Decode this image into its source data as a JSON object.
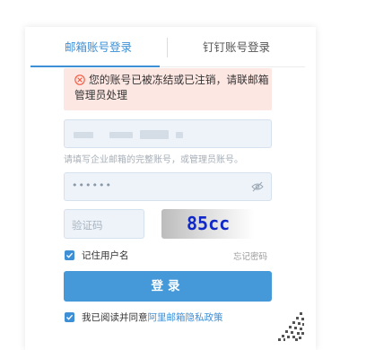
{
  "tabs": {
    "email_login": "邮箱账号登录",
    "dingtalk_login": "钉钉账号登录"
  },
  "alert": {
    "message": "您的账号已被冻结或已注销，请联邮箱管理员处理",
    "icon": "error-circle-icon",
    "color": "#f1573d"
  },
  "email": {
    "hint": "请填写企业邮箱的完整账号，或管理员账号。"
  },
  "password": {
    "masked_value": "••••••",
    "icon": "eye-slash-icon"
  },
  "captcha": {
    "placeholder": "验证码",
    "image_text": "85cc"
  },
  "remember": {
    "label": "记住用户名",
    "checked": true
  },
  "forgot_password": "忘记密码",
  "login_button": "登录",
  "agreement": {
    "prefix": "我已阅读并同意",
    "link": "阿里邮箱隐私政策",
    "checked": true
  },
  "colors": {
    "accent": "#3d8fd6",
    "button": "#4699d8",
    "alert_bg": "#fde7e3"
  }
}
